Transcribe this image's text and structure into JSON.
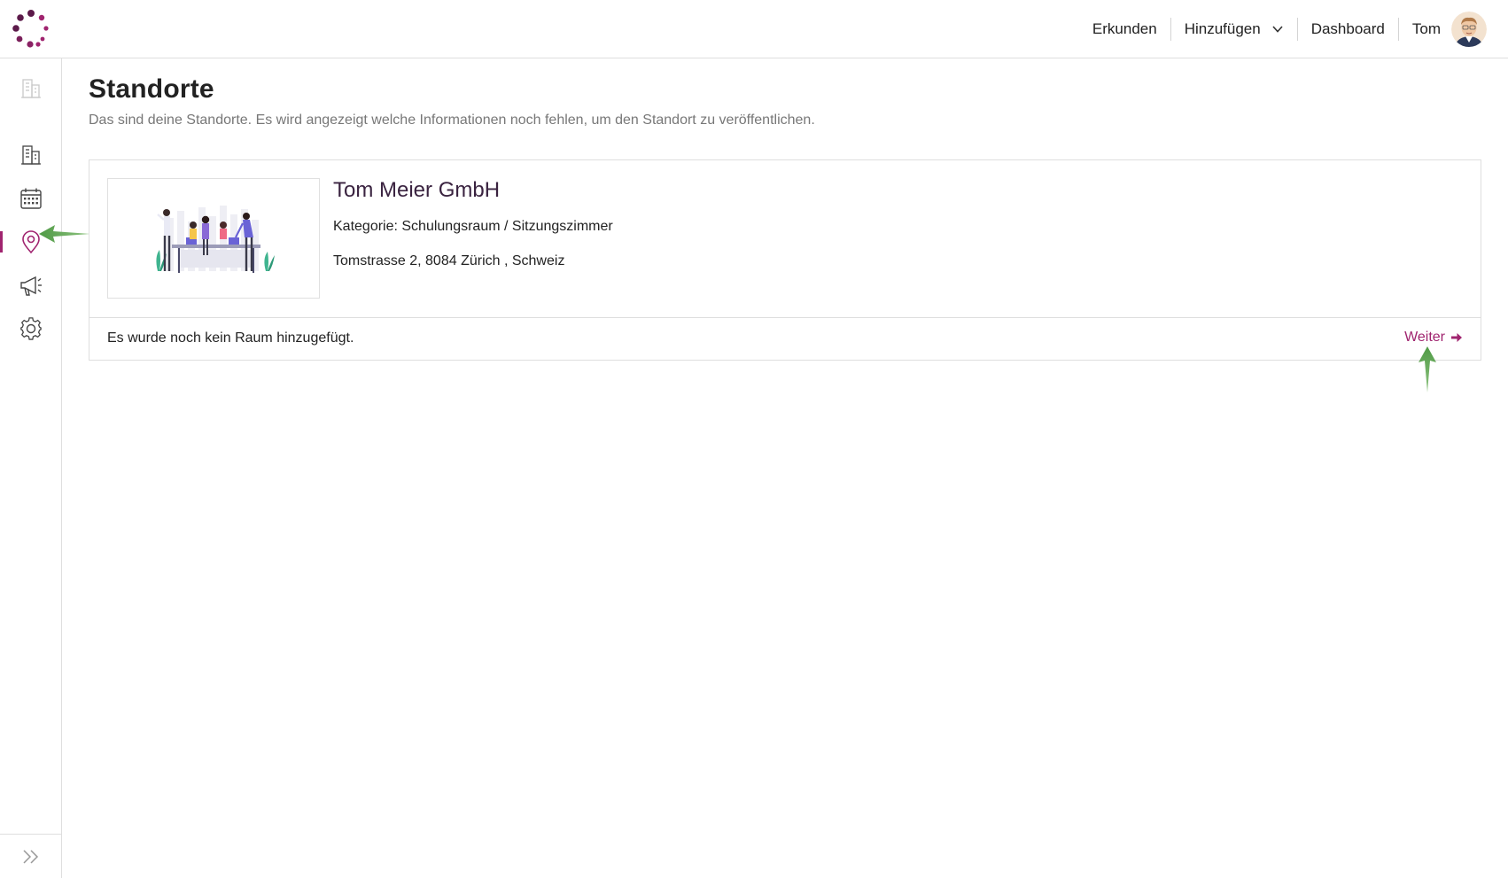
{
  "colors": {
    "accent": "#a0246f",
    "logo_dark": "#5c1a4a",
    "annotation_arrow": "#5e9e4e"
  },
  "header": {
    "nav": {
      "explore": "Erkunden",
      "add": "Hinzufügen",
      "dashboard": "Dashboard",
      "user": "Tom"
    }
  },
  "sidebar": {
    "items": [
      {
        "name": "sidebar-item-buildings-disabled",
        "icon": "building-icon"
      },
      {
        "name": "sidebar-item-buildings",
        "icon": "building-icon"
      },
      {
        "name": "sidebar-item-calendar",
        "icon": "calendar-icon"
      },
      {
        "name": "sidebar-item-locations",
        "icon": "map-pin-icon",
        "active": true
      },
      {
        "name": "sidebar-item-marketing",
        "icon": "megaphone-icon"
      },
      {
        "name": "sidebar-item-settings",
        "icon": "gear-icon"
      }
    ],
    "footer_icon": "double-chevron-right-icon"
  },
  "main": {
    "title": "Standorte",
    "subtitle": "Das sind deine Standorte. Es wird angezeigt welche Informationen noch fehlen, um den Standort zu veröffentlichen.",
    "location": {
      "name": "Tom Meier GmbH",
      "category": "Kategorie: Schulungsraum / Sitzungszimmer",
      "address": "Tomstrasse 2, 8084 Zürich , Schweiz",
      "empty_message": "Es wurde noch kein Raum hinzugefügt.",
      "next_label": "Weiter"
    }
  }
}
